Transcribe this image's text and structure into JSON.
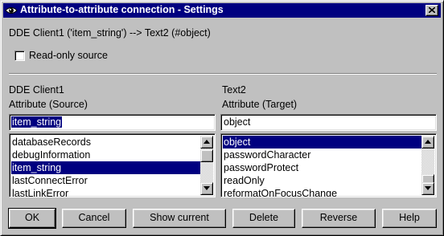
{
  "window": {
    "title": "Attribute-to-attribute connection - Settings"
  },
  "connection": {
    "description": "DDE Client1 ('item_string') --> Text2 (#object)"
  },
  "options": {
    "read_only_label": "Read-only source",
    "read_only_checked": false
  },
  "source": {
    "object_name": "DDE Client1",
    "attribute_label": "Attribute (Source)",
    "value": "item_string",
    "items": [
      {
        "label": "databaseRecords",
        "selected": false
      },
      {
        "label": "debugInformation",
        "selected": false
      },
      {
        "label": "item_string",
        "selected": true
      },
      {
        "label": "lastConnectError",
        "selected": false
      },
      {
        "label": "lastLinkError",
        "selected": false
      }
    ]
  },
  "target": {
    "object_name": "Text2",
    "attribute_label": "Attribute (Target)",
    "value": "object",
    "items": [
      {
        "label": "object",
        "selected": true
      },
      {
        "label": "passwordCharacter",
        "selected": false
      },
      {
        "label": "passwordProtect",
        "selected": false
      },
      {
        "label": "readOnly",
        "selected": false
      },
      {
        "label": "reformatOnFocusChange",
        "selected": false
      }
    ]
  },
  "buttons": {
    "ok": "OK",
    "cancel": "Cancel",
    "show_current": "Show current",
    "delete": "Delete",
    "reverse": "Reverse",
    "help": "Help"
  },
  "colors": {
    "title_bar": "#000080",
    "selection": "#000080",
    "face": "#c0c0c0"
  }
}
